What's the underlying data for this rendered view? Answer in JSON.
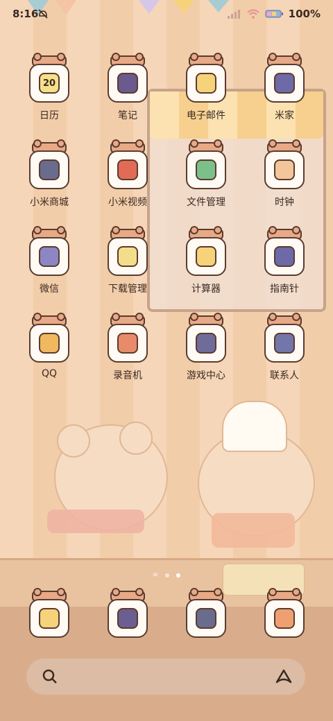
{
  "status": {
    "time": "8:16",
    "battery_label": "100%",
    "icons": [
      "mute-icon",
      "signal-icon",
      "wifi-icon",
      "battery-icon"
    ]
  },
  "apps": [
    {
      "label": "日历",
      "icon": "calendar-icon",
      "glyph": "20",
      "color": "#f7e08a"
    },
    {
      "label": "笔记",
      "icon": "notes-icon",
      "glyph": "",
      "color": "#6b5a8e"
    },
    {
      "label": "电子邮件",
      "icon": "email-icon",
      "glyph": "",
      "color": "#f6d27a"
    },
    {
      "label": "米家",
      "icon": "mijia-icon",
      "glyph": "",
      "color": "#6d6aa6"
    },
    {
      "label": "小米商城",
      "icon": "mi-store-icon",
      "glyph": "",
      "color": "#6a6c8e"
    },
    {
      "label": "小米视频",
      "icon": "mi-video-icon",
      "glyph": "",
      "color": "#e26b55"
    },
    {
      "label": "文件管理",
      "icon": "file-manager-icon",
      "glyph": "",
      "color": "#7bbf8a"
    },
    {
      "label": "时钟",
      "icon": "clock-icon",
      "glyph": "",
      "color": "#f3c59a"
    },
    {
      "label": "微信",
      "icon": "wechat-icon",
      "glyph": "",
      "color": "#8e86c4"
    },
    {
      "label": "下载管理",
      "icon": "download-icon",
      "glyph": "",
      "color": "#f4dd8a"
    },
    {
      "label": "计算器",
      "icon": "calculator-icon",
      "glyph": "",
      "color": "#f6d27a"
    },
    {
      "label": "指南针",
      "icon": "compass-icon",
      "glyph": "",
      "color": "#6e6aa8"
    },
    {
      "label": "QQ",
      "icon": "qq-icon",
      "glyph": "",
      "color": "#f0b860"
    },
    {
      "label": "录音机",
      "icon": "recorder-icon",
      "glyph": "",
      "color": "#e88b6b"
    },
    {
      "label": "游戏中心",
      "icon": "game-center-icon",
      "glyph": "",
      "color": "#6f6c99"
    },
    {
      "label": "联系人",
      "icon": "contacts-icon",
      "glyph": "",
      "color": "#7276a8"
    }
  ],
  "dock": [
    {
      "icon": "phone-icon",
      "color": "#f6d27a"
    },
    {
      "icon": "messages-icon",
      "color": "#6a5f90"
    },
    {
      "icon": "browser-icon",
      "color": "#6a6c8e"
    },
    {
      "icon": "camera-icon",
      "color": "#f0a070"
    }
  ],
  "page_indicator": {
    "pages": 2,
    "current": 2
  },
  "search": {
    "search_icon": "search-icon",
    "assistant_icon": "assistant-icon"
  }
}
